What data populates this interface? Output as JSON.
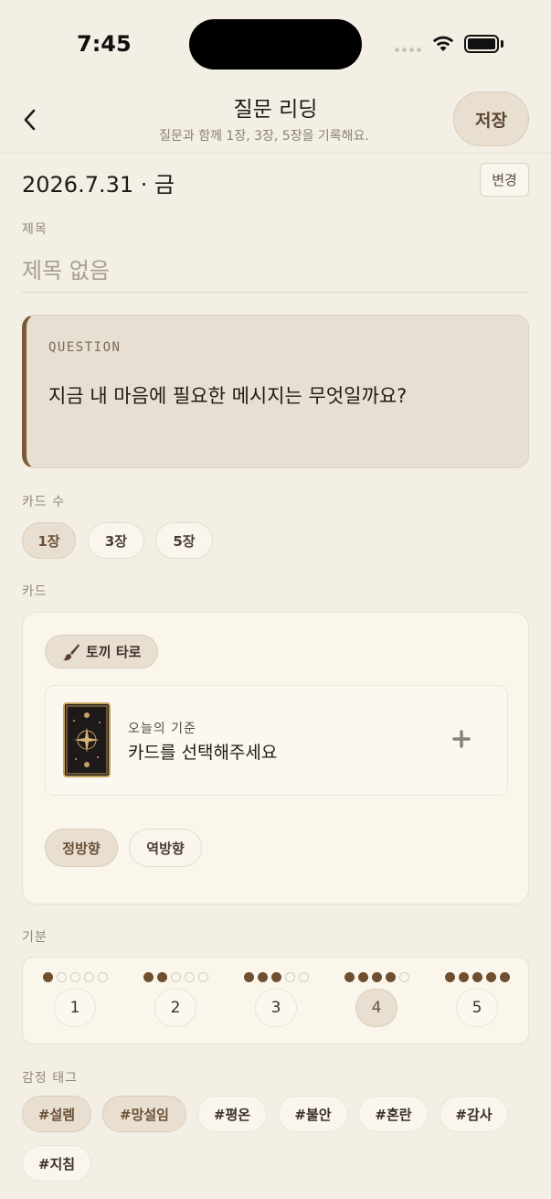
{
  "status": {
    "time": "7:45"
  },
  "header": {
    "title": "질문 리딩",
    "subtitle": "질문과 함께 1장, 3장, 5장을 기록해요.",
    "save_label": "저장"
  },
  "date": {
    "value": "2026.7.31 · 금",
    "change_label": "변경"
  },
  "title_field": {
    "label": "제목",
    "placeholder": "제목 없음",
    "value": ""
  },
  "question": {
    "eyebrow": "QUESTION",
    "text": "지금 내 마음에 필요한 메시지는 무엇일까요?"
  },
  "card_count": {
    "label": "카드 수",
    "options": [
      "1장",
      "3장",
      "5장"
    ],
    "selected": "1장"
  },
  "cards": {
    "label": "카드",
    "deck_label": "토끼 타로",
    "slot_position": "오늘의 기준",
    "slot_prompt": "카드를 선택해주세요",
    "orientation": {
      "upright": "정방향",
      "reversed": "역방향",
      "selected": "정방향"
    }
  },
  "mood": {
    "label": "기분",
    "options": [
      "1",
      "2",
      "3",
      "4",
      "5"
    ],
    "selected": 4
  },
  "emotion_tags": {
    "label": "감정 태그",
    "tags": [
      "#설렘",
      "#망설임",
      "#평온",
      "#불안",
      "#혼란",
      "#감사",
      "#지침"
    ],
    "selected": [
      "#설렘",
      "#망설임"
    ]
  },
  "colors": {
    "background": "#f4efe4",
    "accent": "#6f4f30",
    "chip_active": "#e8dfd1"
  }
}
